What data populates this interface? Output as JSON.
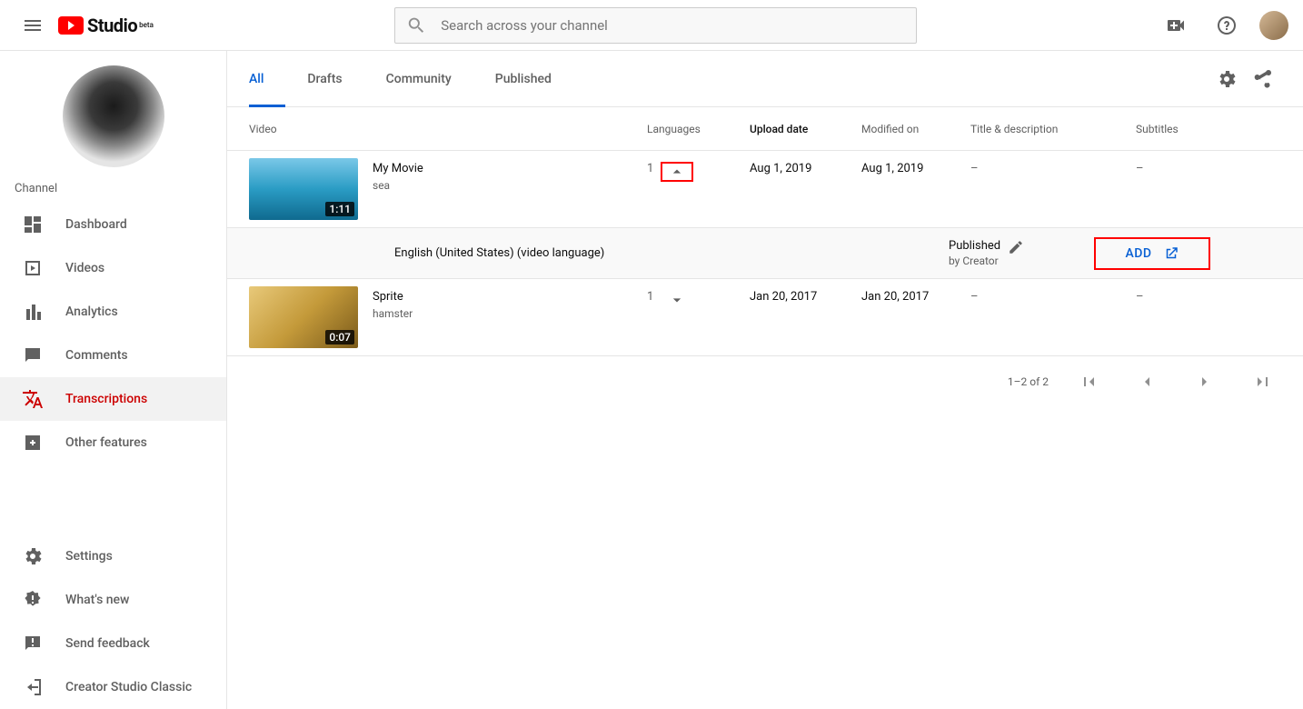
{
  "header": {
    "logo_text": "Studio",
    "logo_beta": "beta",
    "search_placeholder": "Search across your channel"
  },
  "sidebar": {
    "channel_label": "Channel",
    "items": [
      {
        "label": "Dashboard"
      },
      {
        "label": "Videos"
      },
      {
        "label": "Analytics"
      },
      {
        "label": "Comments"
      },
      {
        "label": "Transcriptions"
      },
      {
        "label": "Other features"
      }
    ],
    "footer": [
      {
        "label": "Settings"
      },
      {
        "label": "What's new"
      },
      {
        "label": "Send feedback"
      },
      {
        "label": "Creator Studio Classic"
      }
    ]
  },
  "tabs": [
    {
      "label": "All"
    },
    {
      "label": "Drafts"
    },
    {
      "label": "Community"
    },
    {
      "label": "Published"
    }
  ],
  "columns": {
    "video": "Video",
    "languages": "Languages",
    "upload": "Upload date",
    "modified": "Modified on",
    "titledesc": "Title & description",
    "subtitles": "Subtitles"
  },
  "rows": [
    {
      "title": "My Movie",
      "subtitle": "sea",
      "duration": "1:11",
      "languages": "1",
      "upload": "Aug 1, 2019",
      "modified": "Aug 1, 2019",
      "titledesc": "–",
      "subtitles": "–"
    },
    {
      "title": "Sprite",
      "subtitle": "hamster",
      "duration": "0:07",
      "languages": "1",
      "upload": "Jan 20, 2017",
      "modified": "Jan 20, 2017",
      "titledesc": "–",
      "subtitles": "–"
    }
  ],
  "lang_row": {
    "language": "English (United States) (video language)",
    "status": "Published",
    "status_sub": "by Creator",
    "add_label": "ADD"
  },
  "pagination": {
    "text": "1–2 of 2"
  }
}
